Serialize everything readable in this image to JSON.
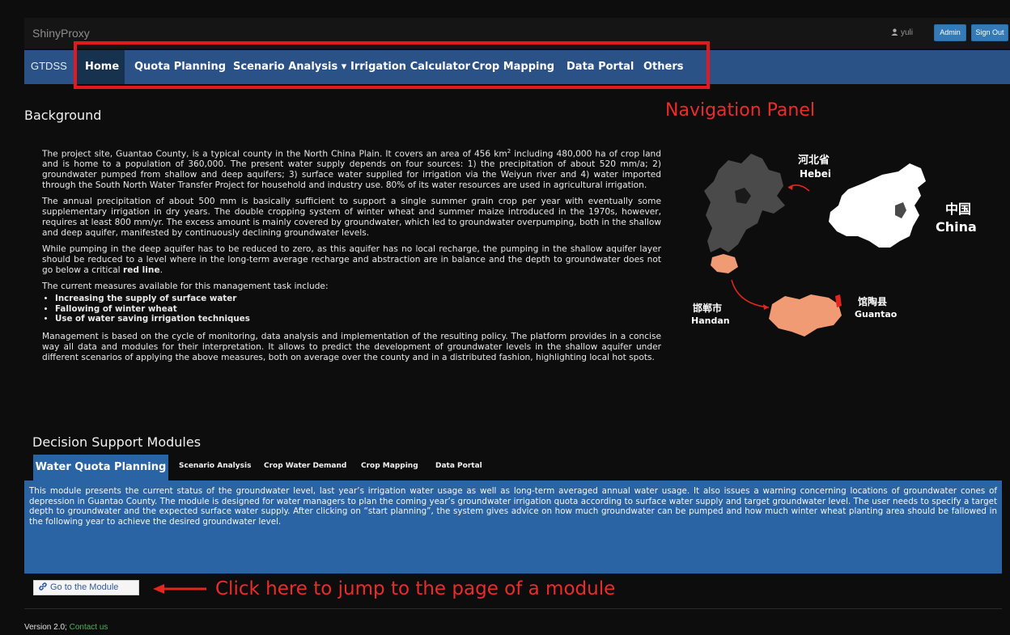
{
  "topbar": {
    "brand": "ShinyProxy",
    "user": "yuli",
    "admin_label": "Admin",
    "signout_label": "Sign Out"
  },
  "navbar": {
    "brand": "GTDSS",
    "items": [
      {
        "label": "Home"
      },
      {
        "label": "Quota Planning"
      },
      {
        "label": "Scenario Analysis ▾"
      },
      {
        "label": "Irrigation Calculator"
      },
      {
        "label": "Crop Mapping"
      },
      {
        "label": "Data Portal"
      },
      {
        "label": "Others"
      }
    ],
    "active": "Home"
  },
  "annotations": {
    "nav_panel": "Navigation Panel",
    "click_here": "Click here to jump to the page of a module"
  },
  "background": {
    "title": "Background",
    "p1_a": "The project site, Guantao County, is a typical county in the North China Plain. It covers an area of 456 km",
    "p1_sup": "2",
    "p1_b": " including 480,000 ha of crop land and is home to a population of 360,000. The present water supply depends on four sources: 1) the precipitation of about 520 mm/a; 2) groundwater pumped from shallow and deep aquifers; 3) surface water supplied for irrigation via the Weiyun river and 4) water imported through the South North Water Transfer Project for household and industry use. 80% of its water resources are used in agricultural irrigation.",
    "p2": "The annual precipitation of about 500 mm is basically sufficient to support a single summer grain crop per year with eventually some supplementary irrigation in dry years. The double cropping system of winter wheat and summer maize introduced in the 1970s, however, requires at least 800 mm/yr. The excess amount is mainly covered by groundwater, which led to groundwater overpumping, both in the shallow and deep aquifer, manifested by continuously declining groundwater levels.",
    "p3_a": "While pumping in the deep aquifer has to be reduced to zero, as this aquifer has no local recharge, the pumping in the shallow aquifer layer should be reduced to a level where in the long-term average recharge and abstraction are in balance and the depth to groundwater does not go below a critical ",
    "p3_bold": "red line",
    "p3_b": ".",
    "p4": "The current measures available for this management task include:",
    "measures": [
      "Increasing the supply of surface water",
      "Fallowing of winter wheat",
      "Use of water saving irrigation techniques"
    ],
    "p5": "Management is based on the cycle of monitoring, data analysis and implementation of the resulting policy. The platform provides in a concise way all data and modules for their interpretation. It allows to predict the development of groundwater levels in the shallow aquifer under different scenarios of applying the above measures, both on average over the county and in a distributed fashion, highlighting local hot spots."
  },
  "map": {
    "hebei_cn": "河北省",
    "hebei_en": "Hebei",
    "china_cn": "中国",
    "china_en": "China",
    "handan_cn": "邯郸市",
    "handan_en": "Handan",
    "guantao_cn": "馆陶县",
    "guantao_en": "Guantao",
    "colors": {
      "hebei": "#4a4a4a",
      "china": "#ffffff",
      "handan": "#f09b73",
      "guantao": "#e3261e",
      "arrow": "#e3261e"
    }
  },
  "modules": {
    "title": "Decision Support Modules",
    "tabs": [
      {
        "label": "Water Quota Planning"
      },
      {
        "label": "Scenario Analysis"
      },
      {
        "label": "Crop Water Demand"
      },
      {
        "label": "Crop Mapping"
      },
      {
        "label": "Data Portal"
      }
    ],
    "active_tab": "Water Quota Planning",
    "description": "This module presents the current status of the groundwater level, last year’s irrigation water usage as well as long-term averaged annual water usage. It also issues a warning concerning locations of groundwater cones of depression in Guantao County. The module is designed for water managers to plan the coming year’s groundwater irrigation quota according to surface water supply and target groundwater level. The user needs to specify a target depth to groundwater and the expected surface water supply. After clicking on “start planning”, the system gives advice on how much groundwater can be pumped and how much winter wheat planting area should be fallowed in the following year to achieve the desired groundwater level.",
    "goto_label": "Go to the Module"
  },
  "footer": {
    "version": "Version 2.0; ",
    "contact": "Contact us"
  },
  "colors": {
    "navbar": "#2a5286",
    "nav_active": "#17324f",
    "panel": "#2a64a5",
    "annotation": "#ed2b2b",
    "button": "#337ab7",
    "contact_link": "#4bb35a"
  }
}
